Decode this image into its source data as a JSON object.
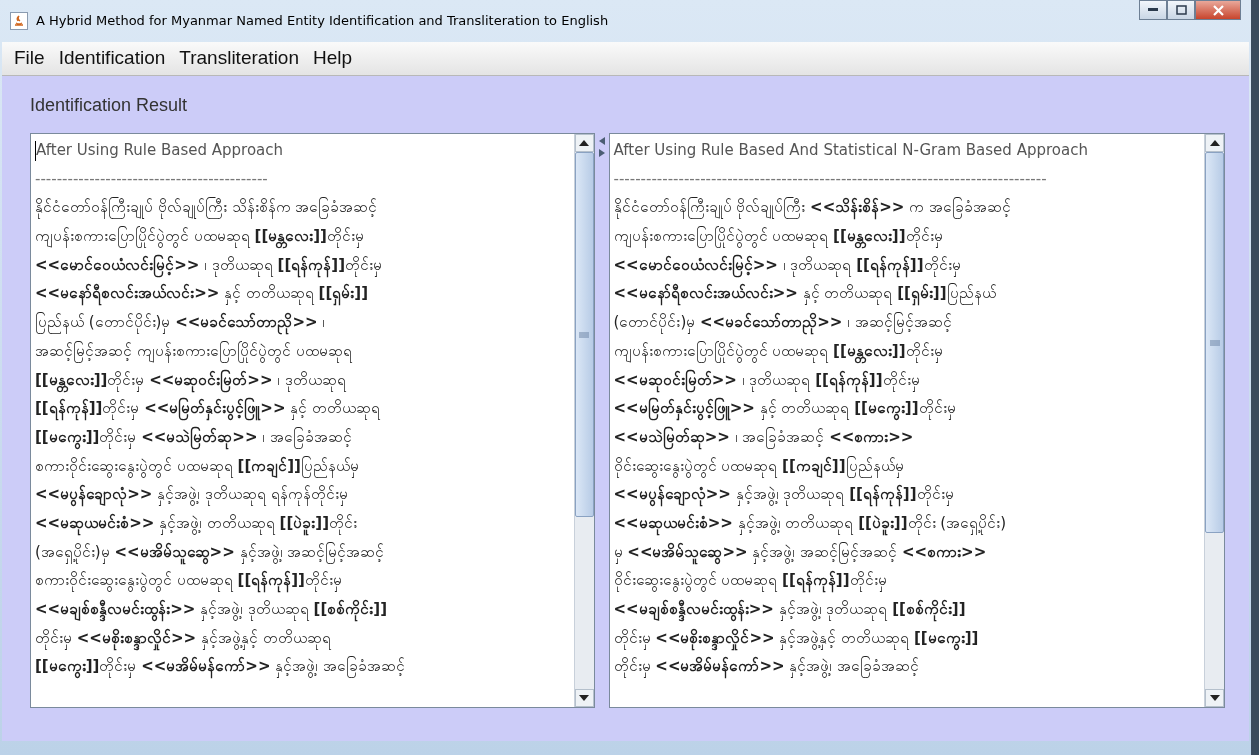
{
  "window": {
    "title": "A Hybrid Method for Myanmar Named Entity Identification and Transliteration to English"
  },
  "menu": [
    "File",
    "Identification",
    "Transliteration",
    "Help"
  ],
  "panel_title": "Identification Result",
  "result_panes": [
    {
      "heading": "After Using Rule Based Approach",
      "separator": "-------------------------------------------",
      "lines": [
        "နိုင်ငံတော်ဝန်ကြီးချုပ် ဗိုလ်ချုပ်ကြီး သိန်းစိန်က အခြေခံအဆင့်",
        "ကျပန်းစကားပြောပြိုင်ပွဲတွင် ပထမဆုရ **[[မန္တလေး]]**တိုင်းမှ",
        "**<<မောင်ဝေယံလင်းမြင့်>>** ၊ ဒုတိယဆုရ **[[ရန်ကုန်]]**တိုင်းမှ",
        "**<<မနော်ရီစလင်းအယ်လင်း>>** နှင့် တတိယဆုရ **[[ရှမ်း]]**",
        "ပြည်နယ် (တောင်ပိုင်း)မှ **<<မခင်သော်တာညို>>** ၊",
        "အဆင့်မြင့်အဆင့် ကျပန်းစကားပြောပြိုင်ပွဲတွင် ပထမဆုရ",
        "**[[မန္တလေး]]**တိုင်းမှ **<<မဆုဝင်းမြတ်>>** ၊ ဒုတိယဆုရ",
        "**[[ရန်ကုန်]]**တိုင်းမှ **<<မမြတ်နှင်းပွင့်ဖြူ>>** နှင့် တတိယဆုရ",
        "**[[မကွေး]]**တိုင်းမှ **<<မသဲမြတ်ဆု>>** ၊ အခြေခံအဆင့်",
        "စကားဝိုင်းဆွေးနွေးပွဲတွင် ပထမဆုရ **[[ကချင်]]**ပြည်နယ်မှ",
        "**<<မပွန်ချောလုံ>>** နှင့်အဖွဲ့၊ ဒုတိယဆုရ ရန်ကုန်တိုင်းမှ",
        "**<<မဆုယမင်းစံ>>** နှင့်အဖွဲ့၊ တတိယဆုရ **[[ပဲခူး]]**တိုင်း",
        "(အရှေ့ပိုင်း)မှ **<<မအိမ်သူဆွေ>>** နှင့်အဖွဲ့၊ အဆင့်မြင့်အဆင့်",
        "စကားဝိုင်းဆွေးနွေးပွဲတွင် ပထမဆုရ **[[ရန်ကုန်]]**တိုင်းမှ",
        "**<<မချစ်စန္ဒီလမင်းထွန်း>>** နှင့်အဖွဲ့၊ ဒုတိယဆုရ **[[စစ်ကိုင်း]]**",
        "တိုင်းမှ **<<မစိုးစန္ဒာလှိုင်>>** နှင့်အဖွဲ့နှင့် တတိယဆုရ",
        "**[[မကွေး]]**တိုင်းမှ **<<မအိမ်မန်ကော်>>** နှင့်အဖွဲ့၊ အခြေခံအဆင့်"
      ]
    },
    {
      "heading": "After Using Rule Based And Statistical N-Gram Based Approach",
      "separator": "--------------------------------------------------------------------------------",
      "lines": [
        "နိုင်ငံတော်ဝန်ကြီးချုပ် ဗိုလ်ချုပ်ကြီး **<<သိန်းစိန်>>** က အခြေခံအဆင့်",
        "ကျပန်းစကားပြောပြိုင်ပွဲတွင် ပထမဆုရ **[[မန္တလေး]]**တိုင်းမှ",
        "**<<မောင်ဝေယံလင်းမြင့်>>** ၊ ဒုတိယဆုရ **[[ရန်ကုန်]]**တိုင်းမှ",
        "**<<မနော်ရီစလင်းအယ်လင်း>>** နှင့် တတိယဆုရ **[[ရှမ်း]]**ပြည်နယ်",
        "(တောင်ပိုင်း)မှ **<<မခင်သော်တာညို>>** ၊ အဆင့်မြင့်အဆင့်",
        "ကျပန်းစကားပြောပြိုင်ပွဲတွင် ပထမဆုရ **[[မန္တလေး]]**တိုင်းမှ",
        "**<<မဆုဝင်းမြတ်>>** ၊ ဒုတိယဆုရ **[[ရန်ကုန်]]**တိုင်းမှ",
        "**<<မမြတ်နှင်းပွင့်ဖြူ>>** နှင့် တတိယဆုရ **[[မကွေး]]**တိုင်းမှ",
        "**<<မသဲမြတ်ဆု>>** ၊ အခြေခံအဆင့် **<<စကား>>**",
        "ဝိုင်းဆွေးနွေးပွဲတွင် ပထမဆုရ **[[ကချင်]]**ပြည်နယ်မှ",
        "**<<မပွန်ချောလုံ>>** နှင့်အဖွဲ့၊ ဒုတိယဆုရ **[[ရန်ကုန်]]**တိုင်းမှ",
        "**<<မဆုယမင်းစံ>>** နှင့်အဖွဲ့၊ တတိယဆုရ **[[ပဲခူး]]**တိုင်း (အရှေ့ပိုင်း)",
        "မှ **<<မအိမ်သူဆွေ>>** နှင့်အဖွဲ့၊ အဆင့်မြင့်အဆင့် **<<စကား>>**",
        "ဝိုင်းဆွေးနွေးပွဲတွင် ပထမဆုရ **[[ရန်ကုန်]]**တိုင်းမှ",
        "**<<မချစ်စန္ဒီလမင်းထွန်း>>** နှင့်အဖွဲ့၊ ဒုတိယဆုရ **[[စစ်ကိုင်း]]**",
        "တိုင်းမှ **<<မစိုးစန္ဒာလှိုင်>>** နှင့်အဖွဲ့နှင့် တတိယဆုရ **[[မကွေး]]**",
        "တိုင်းမှ **<<မအိမ်မန်ကော်>>** နှင့်အဖွဲ့၊ အခြေခံအဆင့်"
      ]
    }
  ]
}
